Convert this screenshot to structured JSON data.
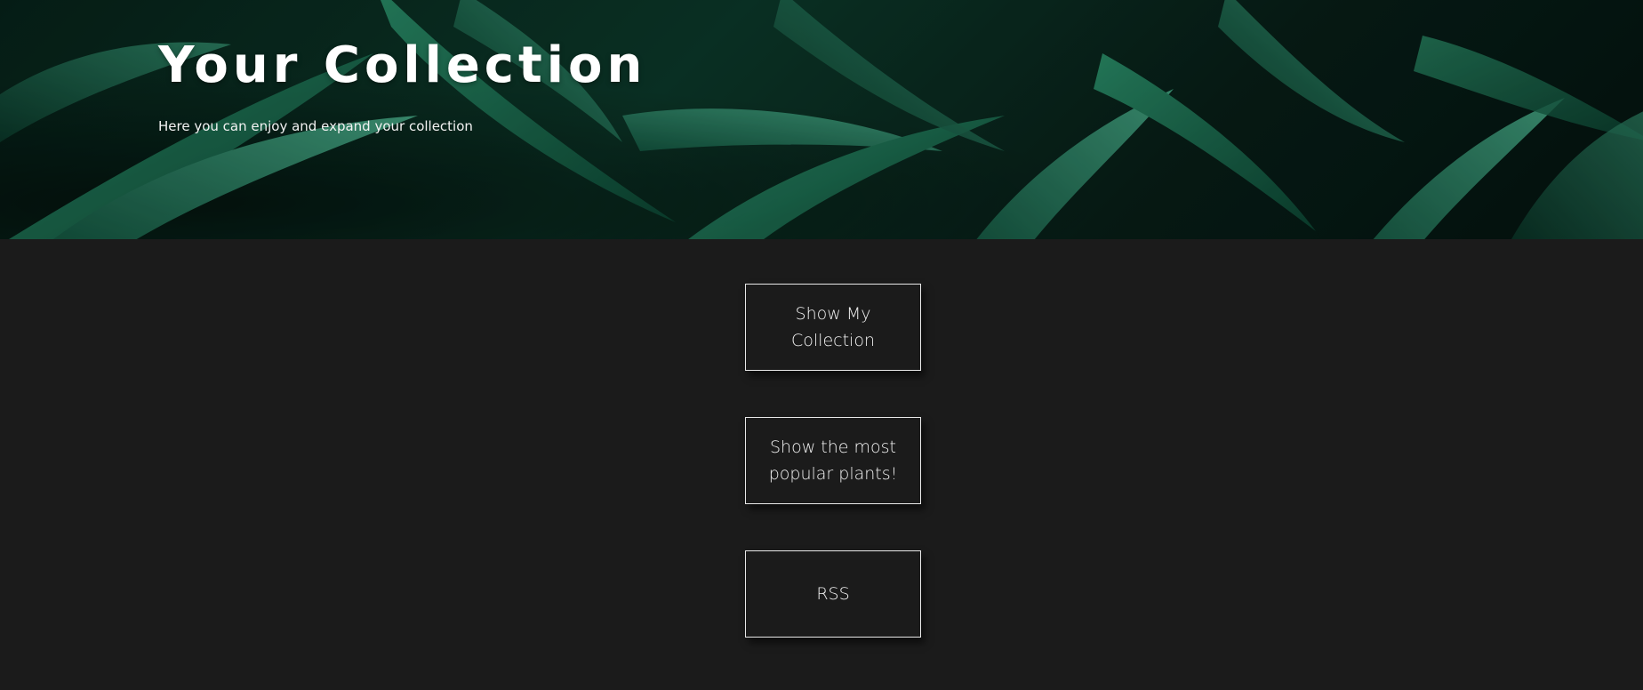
{
  "hero": {
    "title": "Your Collection",
    "subtitle": "Here you can enjoy and expand your collection"
  },
  "actions": {
    "buttons": [
      {
        "label": "Show My Collection"
      },
      {
        "label": "Show the most popular plants!"
      },
      {
        "label": "RSS"
      }
    ]
  },
  "colors": {
    "background": "#1b1b1b",
    "button_border": "#e8e8e8",
    "text": "#ffffff",
    "leaf_green": "#1f7a5a"
  }
}
